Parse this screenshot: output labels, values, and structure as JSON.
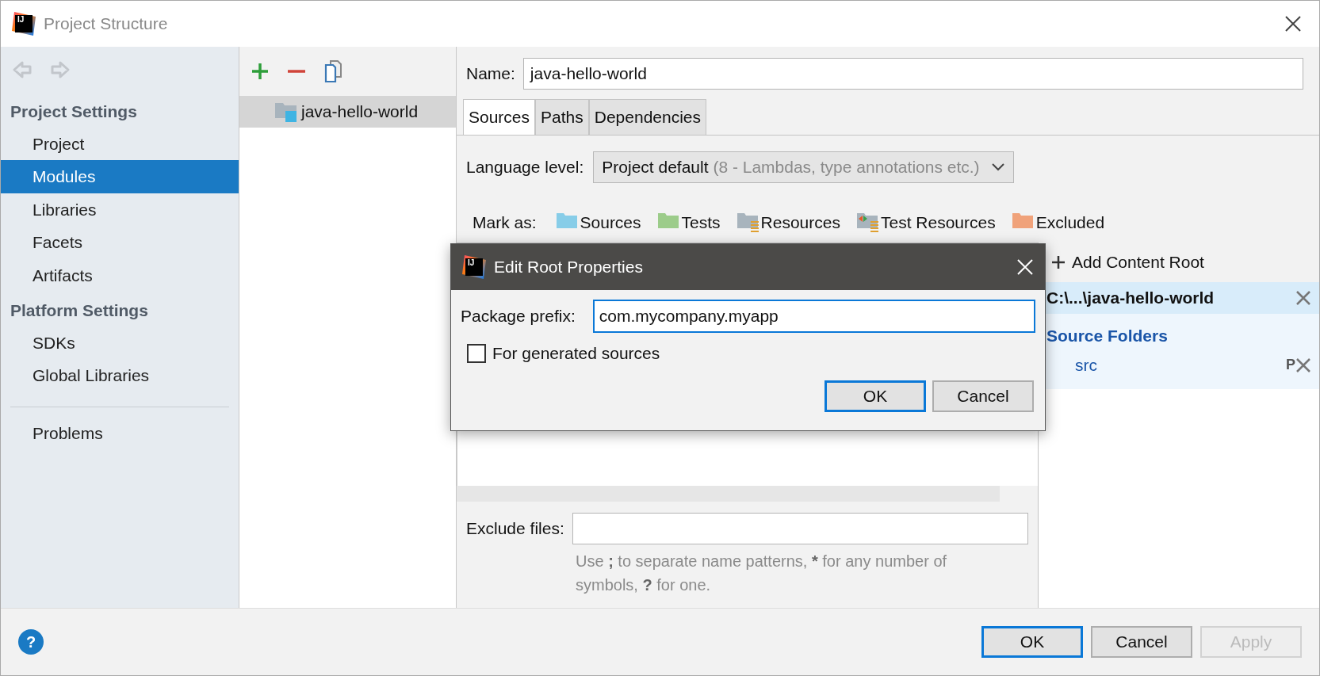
{
  "window": {
    "title": "Project Structure",
    "logo_text": "IJ"
  },
  "nav_buttons": [
    {
      "kind": "back",
      "disabled": true
    },
    {
      "kind": "forward",
      "disabled": true
    }
  ],
  "sidebar": {
    "sections": [
      {
        "heading": "Project Settings",
        "items": [
          {
            "label": "Project",
            "selected": false
          },
          {
            "label": "Modules",
            "selected": true
          },
          {
            "label": "Libraries",
            "selected": false
          },
          {
            "label": "Facets",
            "selected": false
          },
          {
            "label": "Artifacts",
            "selected": false
          }
        ]
      },
      {
        "heading": "Platform Settings",
        "items": [
          {
            "label": "SDKs",
            "selected": false
          },
          {
            "label": "Global Libraries",
            "selected": false
          }
        ]
      },
      {
        "items": [
          {
            "label": "Problems",
            "selected": false
          }
        ]
      }
    ]
  },
  "modules": {
    "toolbar": [
      {
        "kind": "add"
      },
      {
        "kind": "remove"
      },
      {
        "kind": "copy"
      }
    ],
    "items": [
      {
        "label": "java-hello-world",
        "selected": true
      }
    ]
  },
  "module": {
    "name_label": "Name:",
    "name_value": "java-hello-world",
    "tabs": [
      {
        "label": "Sources",
        "selected": true
      },
      {
        "label": "Paths",
        "selected": false
      },
      {
        "label": "Dependencies",
        "selected": false
      }
    ],
    "language_level": {
      "label": "Language level:",
      "value": "Project default",
      "hint": "(8 - Lambdas, type annotations etc.)"
    },
    "mark_as": {
      "label": "Mark as:",
      "items": [
        {
          "kind": "sources",
          "label": "Sources",
          "color": "#87cde8"
        },
        {
          "kind": "tests",
          "label": "Tests",
          "color": "#9ccc8a"
        },
        {
          "kind": "resources",
          "label": "Resources",
          "color": "#a8b4bd"
        },
        {
          "kind": "test_resources",
          "label": "Test Resources",
          "color": "#a8b4bd"
        },
        {
          "kind": "excluded",
          "label": "Excluded",
          "color": "#f0a27a"
        }
      ]
    },
    "exclude_files": {
      "label": "Exclude files:",
      "hint": [
        {
          "text": "Use ",
          "bold": false
        },
        {
          "text": ";",
          "bold": true
        },
        {
          "text": " to separate name patterns, ",
          "bold": false
        },
        {
          "text": "*",
          "bold": true
        },
        {
          "text": " for any number of symbols, ",
          "bold": false
        },
        {
          "text": "?",
          "bold": true
        },
        {
          "text": " for one.",
          "bold": false
        }
      ]
    }
  },
  "content_roots": {
    "add_label": "Add Content Root",
    "roots": [
      {
        "path": "C:\\...\\java-hello-world",
        "sections": [
          {
            "heading": "Source Folders",
            "folders": [
              {
                "name": "src",
                "prefix_marker": "P"
              }
            ]
          }
        ]
      }
    ]
  },
  "dialog": {
    "title": "Edit Root Properties",
    "logo_text": "IJ",
    "prefix_label": "Package prefix:",
    "prefix_value": "com.mycompany.myapp",
    "checkbox": {
      "label": "For generated sources",
      "checked": false
    },
    "buttons": [
      {
        "label": "OK",
        "default": true
      },
      {
        "label": "Cancel",
        "default": false
      }
    ]
  },
  "footer": {
    "help_label": "?",
    "buttons": [
      {
        "label": "OK",
        "default": true,
        "disabled": false
      },
      {
        "label": "Cancel",
        "default": false,
        "disabled": false
      },
      {
        "label": "Apply",
        "default": false,
        "disabled": true
      }
    ]
  }
}
